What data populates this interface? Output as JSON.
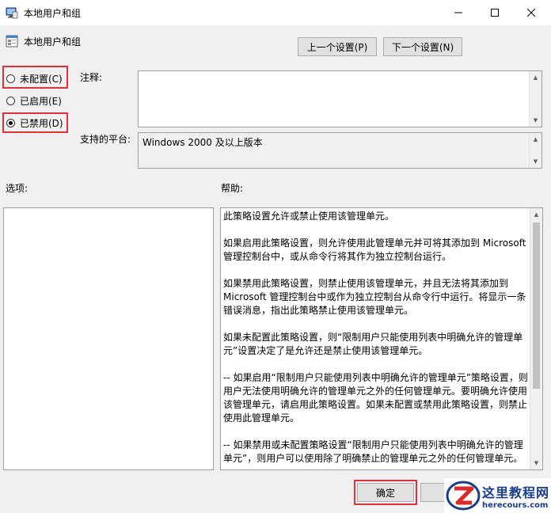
{
  "window": {
    "title": "本地用户和组",
    "controls": {
      "minimize": "—",
      "maximize": "☐",
      "close": "✕"
    }
  },
  "header": {
    "policy_name": "本地用户和组",
    "prev_button": "上一个设置(P)",
    "next_button": "下一个设置(N)"
  },
  "radios": [
    {
      "label": "未配置(C)",
      "selected": false
    },
    {
      "label": "已启用(E)",
      "selected": false
    },
    {
      "label": "已禁用(D)",
      "selected": true
    }
  ],
  "labels": {
    "comment": "注释:",
    "platform": "支持的平台:",
    "options": "选项:",
    "help": "帮助:"
  },
  "comment_value": "",
  "platform_value": "Windows 2000 及以上版本",
  "help_paragraphs": [
    "此策略设置允许或禁止使用该管理单元。",
    "如果启用此策略设置，则允许使用此管理单元并可将其添加到 Microsoft 管理控制台中，或从命令行将其作为独立控制台运行。",
    "如果禁用此策略设置，则禁止使用该管理单元，并且无法将其添加到 Microsoft 管理控制台中或作为独立控制台从命令行中运行。将显示一条错误消息，指出此策略禁止使用该管理单元。",
    "如果未配置此策略设置，则“限制用户只能使用列表中明确允许的管理单元”设置决定了是允许还是禁止使用该管理单元。",
    "-- 如果启用“限制用户只能使用列表中明确允许的管理单元”策略设置，则用户无法使用明确允许的管理单元之外的任何管理单元。要明确允许使用该管理单元，请启用此策略设置。如果未配置或禁用此策略设置，则禁止使用此管理单元。",
    "-- 如果禁用或未配置策略设置“限制用户只能使用列表中明确允许的管理单元”，则用户可以使用除了明确禁止的管理单元之外的任何管理单元。"
  ],
  "footer": {
    "ok_button": "确定",
    "cancel_button": ""
  },
  "watermark": {
    "text_cn": "这里教程网",
    "text_en": "herecours.com"
  },
  "colors": {
    "highlight": "#e0313a",
    "button_bg": "#e1e1e1",
    "dialog_bg": "#f0f0f0",
    "watermark_blue": "#1a3c8c"
  }
}
